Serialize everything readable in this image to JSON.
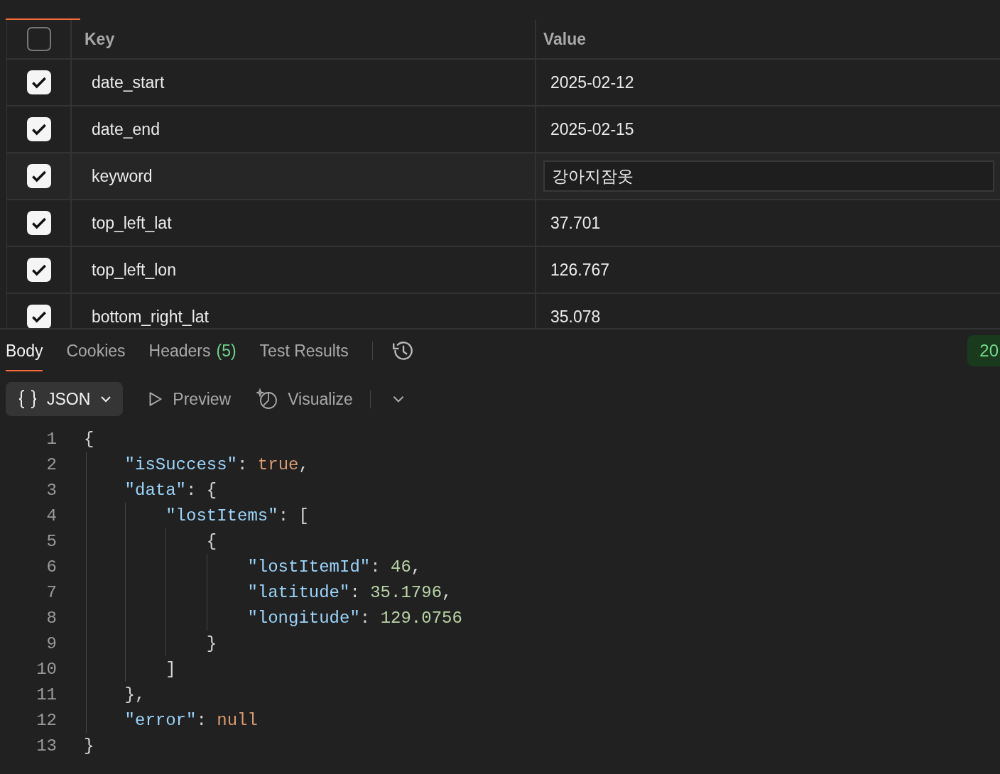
{
  "params": {
    "columns": [
      "Key",
      "Value"
    ],
    "all_checked": false,
    "rows": [
      {
        "checked": true,
        "key": "date_start",
        "value": "2025-02-12",
        "focused": false
      },
      {
        "checked": true,
        "key": "date_end",
        "value": "2025-02-15",
        "focused": false
      },
      {
        "checked": true,
        "key": "keyword",
        "value": "강아지잠옷",
        "focused": true
      },
      {
        "checked": true,
        "key": "top_left_lat",
        "value": "37.701",
        "focused": false
      },
      {
        "checked": true,
        "key": "top_left_lon",
        "value": "126.767",
        "focused": false
      },
      {
        "checked": true,
        "key": "bottom_right_lat",
        "value": "35.078",
        "focused": false
      }
    ]
  },
  "response_tabs": [
    {
      "label": "Body",
      "selected": true
    },
    {
      "label": "Cookies",
      "selected": false
    },
    {
      "label": "Headers",
      "count": "(5)",
      "selected": false
    },
    {
      "label": "Test Results",
      "selected": false
    }
  ],
  "status": "20",
  "toolbar": {
    "format": "JSON",
    "preview": "Preview",
    "visualize": "Visualize"
  },
  "code": [
    {
      "number": "1",
      "tokens": [
        {
          "kind": "punct",
          "text": "{"
        }
      ]
    },
    {
      "number": "2",
      "tokens": [
        {
          "kind": "key",
          "text": "\"isSuccess\""
        },
        {
          "kind": "punct",
          "text": ": "
        },
        {
          "kind": "literal",
          "text": "true"
        },
        {
          "kind": "punct",
          "text": ","
        }
      ]
    },
    {
      "number": "3",
      "tokens": [
        {
          "kind": "key",
          "text": "\"data\""
        },
        {
          "kind": "punct",
          "text": ": {"
        }
      ]
    },
    {
      "number": "4",
      "tokens": [
        {
          "kind": "key",
          "text": "\"lostItems\""
        },
        {
          "kind": "punct",
          "text": ": ["
        }
      ]
    },
    {
      "number": "5",
      "tokens": [
        {
          "kind": "punct",
          "text": "{"
        }
      ]
    },
    {
      "number": "6",
      "tokens": [
        {
          "kind": "key",
          "text": "\"lostItemId\""
        },
        {
          "kind": "punct",
          "text": ": "
        },
        {
          "kind": "number",
          "text": "46"
        },
        {
          "kind": "punct",
          "text": ","
        }
      ]
    },
    {
      "number": "7",
      "tokens": [
        {
          "kind": "key",
          "text": "\"latitude\""
        },
        {
          "kind": "punct",
          "text": ": "
        },
        {
          "kind": "number",
          "text": "35.1796"
        },
        {
          "kind": "punct",
          "text": ","
        }
      ]
    },
    {
      "number": "8",
      "tokens": [
        {
          "kind": "key",
          "text": "\"longitude\""
        },
        {
          "kind": "punct",
          "text": ": "
        },
        {
          "kind": "number",
          "text": "129.0756"
        }
      ]
    },
    {
      "number": "9",
      "tokens": [
        {
          "kind": "punct",
          "text": "}"
        }
      ]
    },
    {
      "number": "10",
      "tokens": [
        {
          "kind": "punct",
          "text": "]"
        }
      ]
    },
    {
      "number": "11",
      "tokens": [
        {
          "kind": "punct",
          "text": "},"
        }
      ]
    },
    {
      "number": "12",
      "tokens": [
        {
          "kind": "key",
          "text": "\"error\""
        },
        {
          "kind": "punct",
          "text": ": "
        },
        {
          "kind": "literal",
          "text": "null"
        }
      ]
    },
    {
      "number": "13",
      "tokens": [
        {
          "kind": "punct",
          "text": "}"
        }
      ]
    }
  ]
}
